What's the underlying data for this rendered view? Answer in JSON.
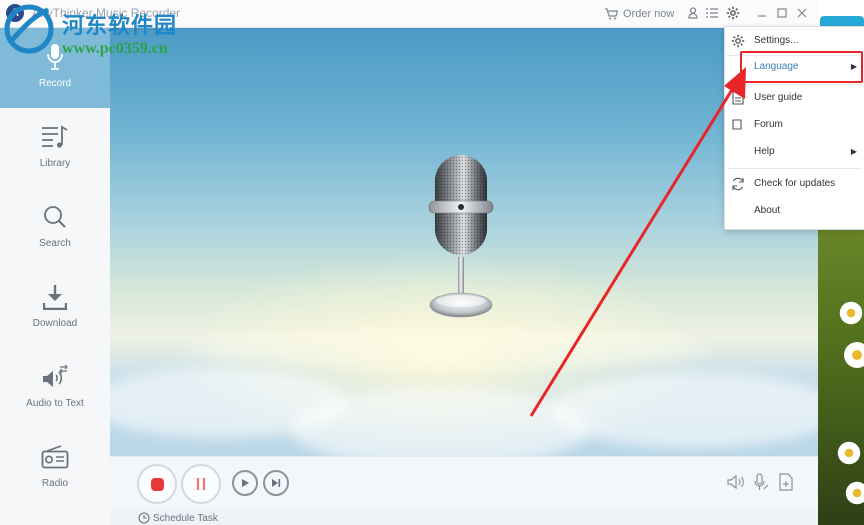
{
  "window": {
    "title": "AnyThinker Music Recorder",
    "order_now": "Order now"
  },
  "watermark": {
    "site_name": "河东软件园",
    "site_url": "www.pc0359.cn"
  },
  "sidebar": {
    "items": [
      {
        "label": "Record",
        "icon": "microphone-icon",
        "active": true
      },
      {
        "label": "Library",
        "icon": "music-list-icon"
      },
      {
        "label": "Search",
        "icon": "search-icon"
      },
      {
        "label": "Download",
        "icon": "download-icon"
      },
      {
        "label": "Audio to Text",
        "icon": "audio-to-text-icon"
      },
      {
        "label": "Radio",
        "icon": "radio-icon"
      }
    ]
  },
  "menu": {
    "items": [
      {
        "label": "Settings...",
        "icon": "gear-icon"
      },
      {
        "label": "Language",
        "submenu": true,
        "highlighted": true
      },
      {
        "label": "User guide",
        "icon": "document-icon"
      },
      {
        "label": "Forum",
        "icon": "forum-icon"
      },
      {
        "label": "Help",
        "submenu": true
      },
      {
        "label": "Check for updates",
        "icon": "refresh-icon"
      },
      {
        "label": "About"
      }
    ]
  },
  "status": {
    "schedule_task": "Schedule Task"
  },
  "colors": {
    "accent": "#7fbad8",
    "record_red": "#e7383b",
    "annotation_red": "#e8262a",
    "menu_highlight": "#3b7fb7"
  }
}
